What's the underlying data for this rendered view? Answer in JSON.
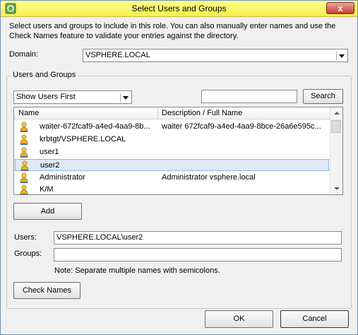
{
  "window": {
    "title": "Select Users and Groups",
    "close_label": "x"
  },
  "intro": "Select users and groups to include in this role. You can also manually enter names and use the Check Names feature to validate your entries against the directory.",
  "domain": {
    "label": "Domain:",
    "value": "VSPHERE.LOCAL"
  },
  "users_groups": {
    "legend": "Users and Groups",
    "filter_value": "Show Users First",
    "search_placeholder": "",
    "search_label": "Search",
    "columns": {
      "name": "Name",
      "description": "Description / Full Name"
    },
    "rows": [
      {
        "name": "waiter-672fcaf9-a4ed-4aa9-8b...",
        "description": "waiter 672fcaf9-a4ed-4aa9-8bce-26a6e595c..."
      },
      {
        "name": "krbtgt/VSPHERE.LOCAL",
        "description": ""
      },
      {
        "name": "user1",
        "description": ""
      },
      {
        "name": "user2",
        "description": "",
        "selected": true
      },
      {
        "name": "Administrator",
        "description": "Administrator vsphere.local"
      },
      {
        "name": "K/M",
        "description": ""
      }
    ],
    "add_label": "Add"
  },
  "users_field": {
    "label": "Users:",
    "value": "VSPHERE.LOCAL\\user2"
  },
  "groups_field": {
    "label": "Groups:",
    "value": ""
  },
  "note": "Note: Separate multiple names with semicolons.",
  "check_names_label": "Check Names",
  "ok_label": "OK",
  "cancel_label": "Cancel",
  "colors": {
    "titlebar": "#f6f04c",
    "selection": "#dfe9f7",
    "user_icon": "#e8b02a"
  }
}
